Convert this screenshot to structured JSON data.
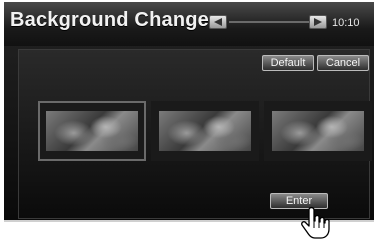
{
  "header": {
    "title": "Background Change",
    "clock": "10:10",
    "prev_icon": "triangle-left-icon",
    "next_icon": "triangle-right-icon"
  },
  "toolbar": {
    "default_label": "Default",
    "cancel_label": "Cancel"
  },
  "thumbnails": [
    {
      "selected": true
    },
    {
      "selected": false
    },
    {
      "selected": false
    }
  ],
  "actions": {
    "enter_label": "Enter"
  },
  "pointer": {
    "icon": "hand-pointer-icon"
  },
  "colors": {
    "screen_bg": "#111111",
    "button_border": "#bbbbbb",
    "text": "#f2f2f2"
  }
}
